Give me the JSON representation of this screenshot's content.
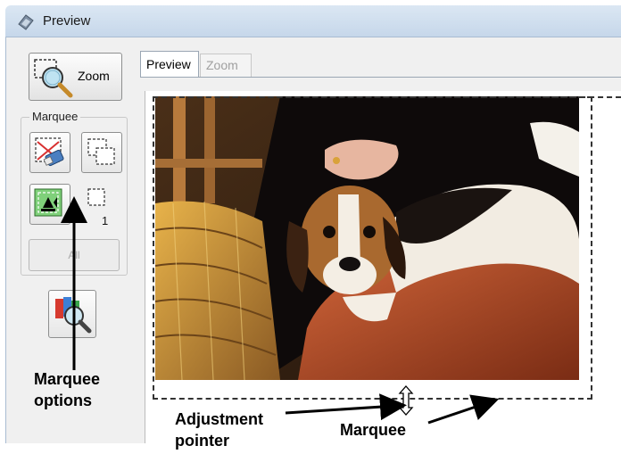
{
  "window": {
    "title": "Preview"
  },
  "toolbar": {
    "zoom_label": "Zoom",
    "marquee_group_label": "Marquee",
    "marquee_count": "1",
    "all_label": "All"
  },
  "tabs": [
    {
      "label": "Preview",
      "active": true
    },
    {
      "label": "Zoom",
      "active": false
    }
  ],
  "annotations": {
    "marquee_options": [
      "Marquee",
      "options"
    ],
    "adjustment_pointer": [
      "Adjustment",
      "pointer"
    ],
    "marquee": "Marquee"
  },
  "icons": {
    "app": "preview-app-icon",
    "zoom": "zoom-magnifier-icon",
    "delete_marquee": "delete-marquee-icon",
    "duplicate_marquee": "duplicate-marquee-icon",
    "auto_locate": "auto-locate-icon",
    "marquee_count": "marquee-count-icon",
    "color": "color-palette-magnifier-icon",
    "cursor": "vertical-resize-cursor-icon"
  },
  "colors": {
    "title_bar": "#c6d7ea",
    "disabled_text": "#a8a8a8",
    "marquee_line": "#333333"
  }
}
